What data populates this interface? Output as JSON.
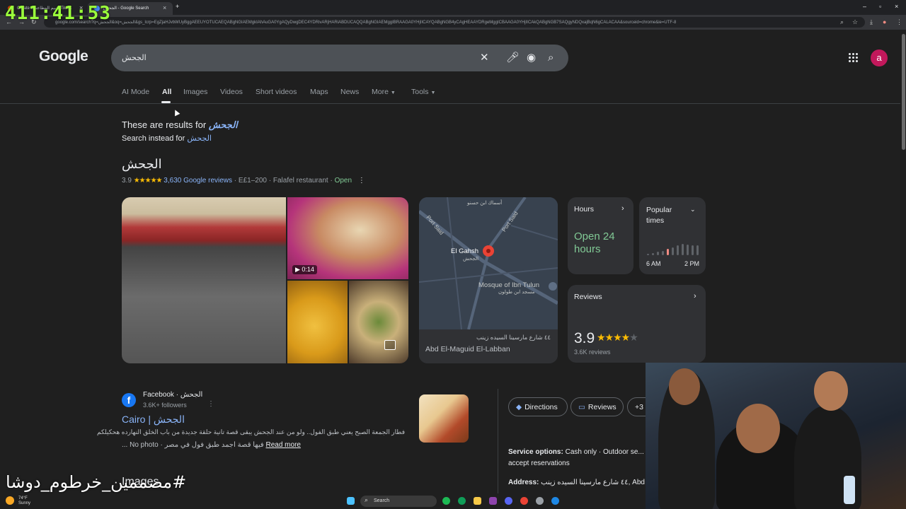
{
  "browser": {
    "tabs": [
      {
        "label": "Create a تقييم المطاعم Tiktok"
      },
      {
        "label": "الجحش - Google Search"
      }
    ],
    "url": "google.com/search?q=الجحش&oq=الجحش&gs_lcrp=EgZjaHJvbWUyBggAEEUYOTUCAEQABgNGIAEMgkIAhAuGA0YgAQyDwgDEC4YDRivARjHARiABDUCAQQABgNGIAEMggIBRAAGA0YHjIICAYQABgNGB4yCAgHEAAYDRgeMggICBAAGA0YHjIICAkQABgNGB7SAQgyNDQxajBqN6gCALACAA&sourceid=chrome&ie=UTF-8"
  },
  "overlay": {
    "clock": "411:41:53",
    "watermark": "#مصممين_خرطوم_دوشا"
  },
  "google": {
    "logo": "Google",
    "query": "الجحش",
    "avatar_letter": "a",
    "nav": [
      "AI Mode",
      "All",
      "Images",
      "Videos",
      "Short videos",
      "Maps",
      "News",
      "More",
      "Tools"
    ],
    "nav_active": "All"
  },
  "spelling": {
    "results_for_prefix": "These are results for",
    "corrected": "الجحش",
    "instead_prefix": "Search instead for",
    "original": "الجحش"
  },
  "place": {
    "name": "الجحش",
    "rating": "3.9",
    "stars": "★★★★★",
    "reviews_link": "3,630 Google reviews",
    "price": "E£1–200",
    "category": "Falafel restaurant",
    "status": "Open",
    "video_duration": "▶ 0:14",
    "map": {
      "labels": [
        "El Gahsh",
        "الجحش",
        "Mosque of Ibn Tulun",
        "مسجد ابن طولون",
        "Port Said",
        "Port Said",
        "أسماك ابن حسنو"
      ],
      "address": "٤٤ شارع مارسينا السيده زينب",
      "owner": "Abd El-Maguid El-Labban"
    },
    "hours": {
      "title": "Hours",
      "value": "Open 24 hours"
    },
    "popular": {
      "title": "Popular times",
      "start": "6 AM",
      "end": "2 PM",
      "levels": [
        0.15,
        0.2,
        0.3,
        0.4,
        0.55,
        0.7,
        0.85,
        1.0,
        0.95,
        0.9,
        0.85
      ]
    },
    "reviews": {
      "title": "Reviews",
      "rating": "3.9",
      "filled_stars": "★★★★",
      "empty_stars": "★",
      "count": "3.6K reviews"
    }
  },
  "result": {
    "source": "Facebook · الجحش",
    "followers": "3.6K+ followers",
    "title": "Cairo | الجحش",
    "snippet1": "فطار الجمعة الصبح يعني طبق الفول.. ولو من عند الجحش يبقى قصة تانية حلقة جديدة من باب الخلق النهارده هحكيلكم",
    "snippet2": "... No photo · فيها قصة اجمد طبق فول في مصر",
    "read_more": "Read more"
  },
  "images_heading": "Images",
  "actions": [
    {
      "label": "Directions",
      "icon": "◆"
    },
    {
      "label": "Reviews",
      "icon": "▭"
    },
    {
      "label": "+3",
      "icon": ""
    }
  ],
  "details": {
    "service_label": "Service options:",
    "service_value": "Cash only · Outdoor se... accept reservations",
    "address_label": "Address:",
    "address_value": "٤٤ شارع مارسينا السيده زينب, Abd El-..."
  },
  "taskbar": {
    "search": "Search",
    "weather_temp": "74°F",
    "weather_desc": "Sunny"
  }
}
